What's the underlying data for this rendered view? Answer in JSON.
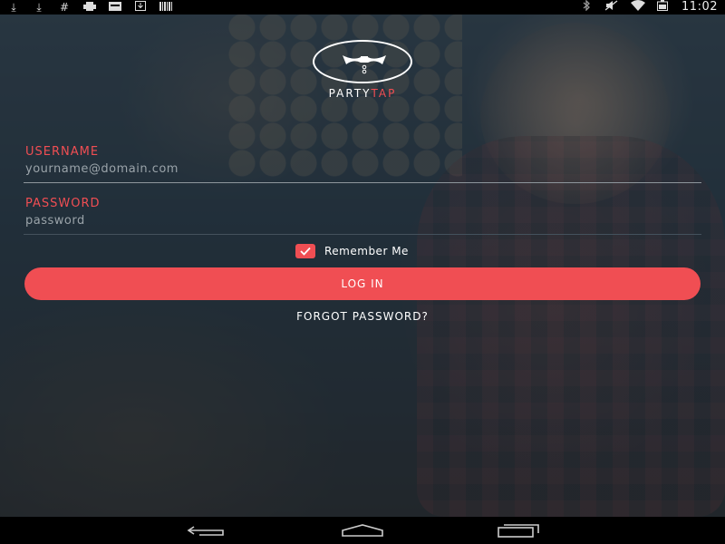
{
  "status_bar": {
    "left_icons": [
      "download-icon",
      "download-icon",
      "hash-icon",
      "printer-icon",
      "card-icon",
      "save-icon",
      "barcode-icon"
    ],
    "right_icons": [
      "bluetooth-icon",
      "mute-icon",
      "wifi-icon",
      "battery-icon"
    ],
    "time": "11:02"
  },
  "logo": {
    "icon": "bowtie-icon",
    "brand_part1": "PARTY",
    "brand_part2": "TAP"
  },
  "form": {
    "username_label": "USERNAME",
    "username_placeholder": "yourname@domain.com",
    "username_value": "",
    "password_label": "PASSWORD",
    "password_placeholder": "password",
    "password_value": "",
    "remember_label": "Remember Me",
    "remember_checked": true,
    "login_label": "LOG IN",
    "forgot_label": "FORGOT PASSWORD?"
  },
  "nav_bar": {
    "buttons": [
      "back-icon",
      "home-icon",
      "recents-icon"
    ]
  },
  "colors": {
    "accent": "#f04e53",
    "text": "#ffffff",
    "placeholder": "#9aa3a9",
    "overlay": "#192632"
  }
}
